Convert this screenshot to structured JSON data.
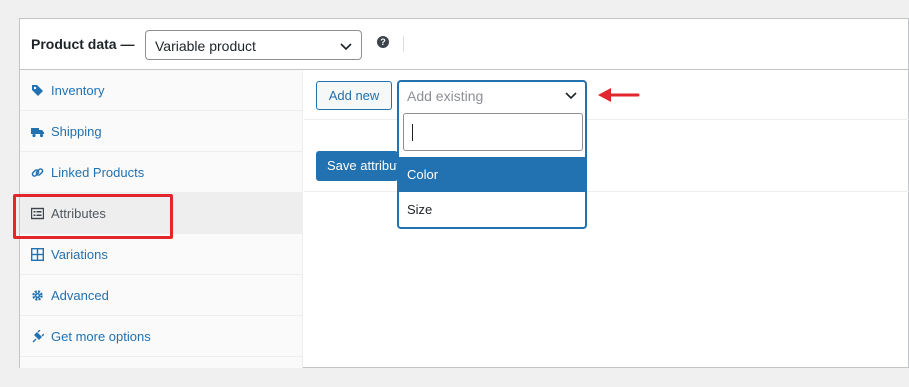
{
  "header": {
    "title": "Product data —",
    "product_type": "Variable product",
    "help_icon": "question-circle-icon"
  },
  "sidebar": {
    "items": [
      {
        "label": "Inventory",
        "icon": "tag-icon"
      },
      {
        "label": "Shipping",
        "icon": "truck-icon"
      },
      {
        "label": "Linked Products",
        "icon": "link-icon"
      },
      {
        "label": "Attributes",
        "icon": "list-view-icon",
        "active": true
      },
      {
        "label": "Variations",
        "icon": "grid-icon"
      },
      {
        "label": "Advanced",
        "icon": "gear-icon"
      },
      {
        "label": "Get more options",
        "icon": "plugin-icon"
      }
    ]
  },
  "attributes": {
    "add_new_label": "Add new",
    "existing_placeholder": "Add existing",
    "options": [
      "Color",
      "Size"
    ],
    "selected_option": "Color",
    "save_label": "Save attributes"
  },
  "colors": {
    "accent": "#2271b1",
    "annotation": "#e2262b"
  }
}
